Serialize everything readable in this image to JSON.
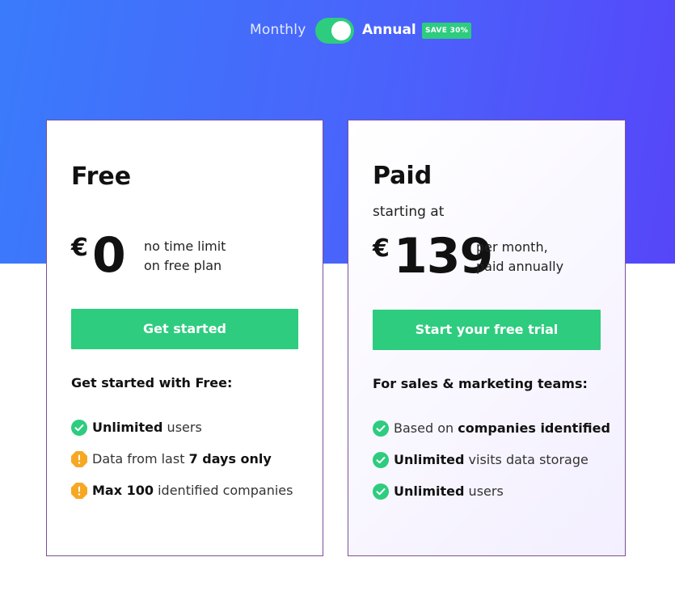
{
  "billing": {
    "monthly_label": "Monthly",
    "annual_label": "Annual",
    "save_badge": "SAVE 30%",
    "selected": "Annual"
  },
  "colors": {
    "accent_green": "#2ecc7f",
    "warning_orange": "#f7a823",
    "hero_gradient_start": "#3a7bfb",
    "hero_gradient_end": "#5646f9",
    "card_border": "#7b4f9a"
  },
  "plans": [
    {
      "name": "Free",
      "starting_at": "",
      "currency": "€",
      "amount": "0",
      "note_line1": "no time limit",
      "note_line2": "on free plan",
      "cta": "Get started",
      "audience": "Get started with Free:",
      "features": [
        {
          "icon": "check-icon",
          "bold": "Unlimited",
          "rest": " users",
          "order": "bold-first"
        },
        {
          "icon": "warning-icon",
          "pre": "Data from last ",
          "bold": "7 days only",
          "order": "text-first"
        },
        {
          "icon": "warning-icon",
          "bold": "Max 100",
          "rest": " identified companies",
          "order": "bold-first"
        }
      ]
    },
    {
      "name": "Paid",
      "starting_at": "starting at",
      "currency": "€",
      "amount": "139",
      "note_line1": "per month,",
      "note_line2": "paid annually",
      "cta": "Start your free trial",
      "audience": "For sales & marketing teams:",
      "features": [
        {
          "icon": "check-icon",
          "pre": "Based on ",
          "bold": "companies identified",
          "order": "text-first"
        },
        {
          "icon": "check-icon",
          "bold": "Unlimited",
          "rest": " visits data storage",
          "order": "bold-first"
        },
        {
          "icon": "check-icon",
          "bold": "Unlimited",
          "rest": " users",
          "order": "bold-first"
        }
      ]
    }
  ]
}
